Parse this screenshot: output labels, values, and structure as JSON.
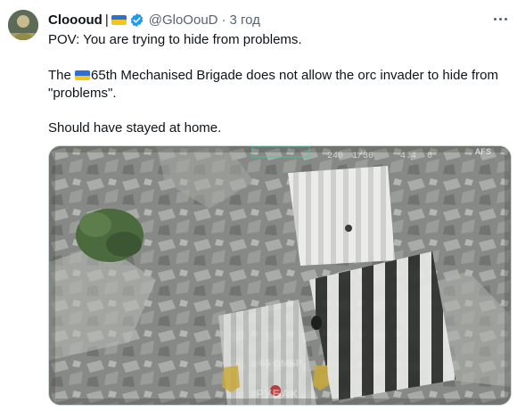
{
  "tweet": {
    "author_name": "Cloooud",
    "name_separator": "|",
    "handle": "@GloOouD",
    "separator_dot": "·",
    "timestamp": "3 год",
    "paragraph1": "POV: You are trying to hide from problems.",
    "paragraph2_prefix": "The ",
    "paragraph2_rest": "65th Mechanised Brigade does not allow the orc invader to hide from \"problems\".",
    "paragraph3": "Should have stayed at home."
  },
  "media": {
    "osd_top": [
      "240",
      "1/30",
      "4.4",
      "0",
      "AFS"
    ],
    "watermark_line1": "65 ОМБР",
    "watermark_line2": "РУБАК"
  },
  "colors": {
    "flag_blue": "#2f6fd1",
    "flag_yellow": "#f5c518",
    "verified": "#1d9bf0",
    "muted_text": "#536471"
  },
  "icons": [
    "ukraine-flag-icon",
    "verified-badge-icon",
    "more-options-icon"
  ]
}
